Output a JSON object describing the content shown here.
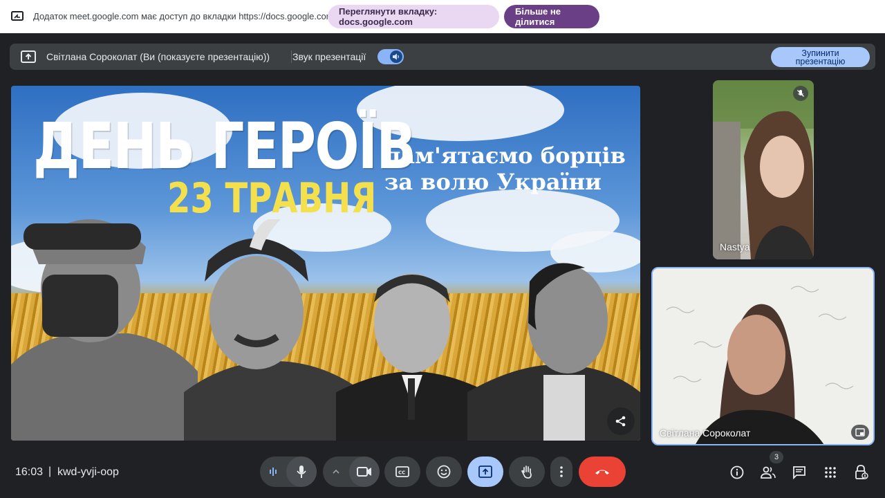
{
  "share_notice": {
    "message": "Додаток meet.google.com має доступ до вкладки https://docs.google.com",
    "view_tab_label": "Переглянути вкладку: docs.google.com",
    "stop_sharing_label": "Більше не ділитися"
  },
  "presentation_bar": {
    "presenter": "Світлана Сороколат (Ви (показуєте презентацію))",
    "audio_label": "Звук презентації",
    "audio_on": true,
    "stop_label": "Зупинити презентацію"
  },
  "slide": {
    "title": "ДЕНЬ ГЕРОЇВ",
    "date": "23 ТРАВНЯ",
    "subtitle_line1": "пам'ятаємо  борців",
    "subtitle_line2": "за волю України"
  },
  "participants": [
    {
      "name": "Nastya",
      "muted": true
    },
    {
      "name": "Світлана Сороколат",
      "muted": false
    }
  ],
  "footer": {
    "time": "16:03",
    "separator": "|",
    "meeting_code": "kwd-yvji-oop",
    "people_count": "3"
  },
  "colors": {
    "background": "#202124",
    "control": "#3c4043",
    "present_active": "#a8c7fa",
    "end_call": "#ea4335",
    "accent": "#8ab4f8"
  }
}
